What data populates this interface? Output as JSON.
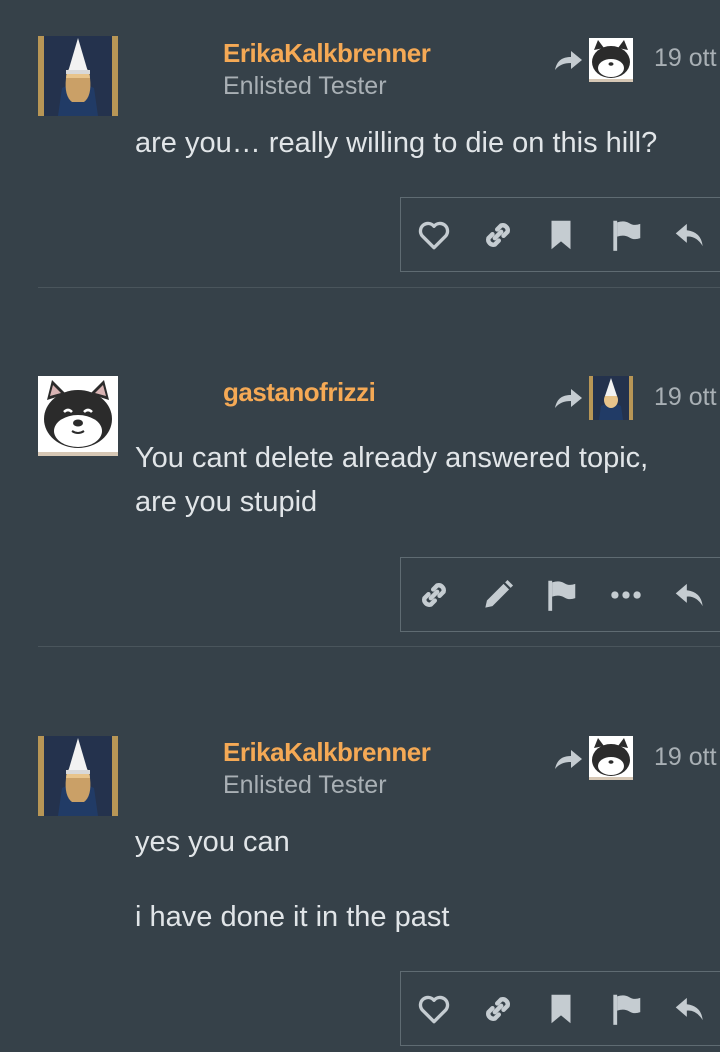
{
  "posts": [
    {
      "author": "ErikaKalkbrenner",
      "user_title": "Enlisted Tester",
      "date": "19 ott",
      "reply_to_avatar": "shiba-dog-avatar",
      "lines": [
        "are you… really willing to die on this hill?"
      ],
      "actions": [
        "heart-icon",
        "link-icon",
        "bookmark-icon",
        "flag-icon",
        "reply-icon"
      ]
    },
    {
      "author": "gastanofrizzi",
      "user_title": "",
      "date": "19 ott",
      "reply_to_avatar": "wizard-hat-avatar",
      "lines": [
        "You cant delete already answered topic,",
        "are you stupid"
      ],
      "actions": [
        "link-icon",
        "edit-pencil-icon",
        "flag-icon",
        "more-dots-icon",
        "reply-icon"
      ]
    },
    {
      "author": "ErikaKalkbrenner",
      "user_title": "Enlisted Tester",
      "date": "19 ott",
      "reply_to_avatar": "shiba-dog-avatar",
      "lines": [
        "yes you can",
        "",
        "i have done it in the past"
      ],
      "actions": [
        "heart-icon",
        "link-icon",
        "bookmark-icon",
        "flag-icon",
        "reply-icon"
      ]
    }
  ],
  "colors": {
    "background": "#364149",
    "username": "#f5a955",
    "muted": "#a9b0b5",
    "text": "#e1e5e8",
    "icon": "#c5ccd1"
  }
}
